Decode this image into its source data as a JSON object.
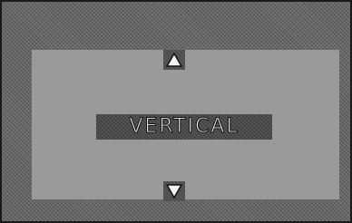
{
  "screen": {
    "mode_label": "VERTICAL",
    "up_arrow_icon": "triangle-up-icon",
    "down_arrow_icon": "triangle-down-icon"
  }
}
